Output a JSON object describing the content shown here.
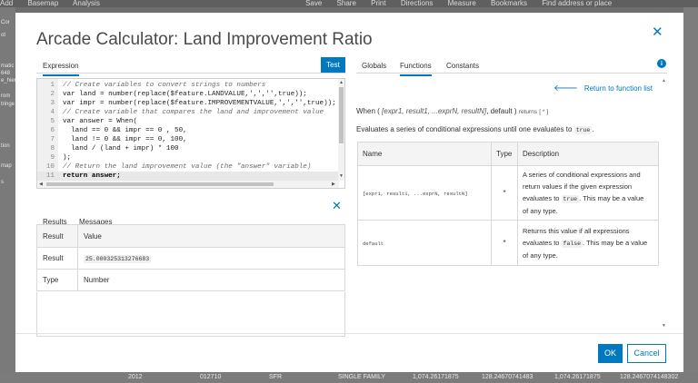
{
  "background_app": {
    "toolbar": [
      "Add",
      "Basemap",
      "Analysis",
      "Save",
      "Share",
      "Print",
      "Directions",
      "Measure",
      "Bookmarks",
      "Find address or place"
    ],
    "left_fragments": [
      "Cor",
      "ot",
      "matic",
      "648",
      "e_hier",
      "rom",
      "tringe",
      "tion",
      "map",
      "s"
    ],
    "bottom_row": [
      "2012",
      "012710",
      "SFR",
      "SINGLE FAMILY",
      "1,074.26171875",
      "128.24670741483",
      "1,074.26171875",
      "128.2467074148302"
    ]
  },
  "dialog": {
    "title": "Arcade Calculator: Land Improvement Ratio",
    "close_icon": "close-icon"
  },
  "left_panel": {
    "tab_expression": "Expression",
    "test_button": "Test",
    "code_lines": [
      {
        "n": "1",
        "text": "// Create variables to convert strings to numbers"
      },
      {
        "n": "2",
        "text": "var land = number(replace($feature.LANDVALUE,',','',true));"
      },
      {
        "n": "3",
        "text": "var impr = number(replace($feature.IMPROVEMENTVALUE,',','',true));"
      },
      {
        "n": "4",
        "text": "// Create variable that compares the land and improvement value"
      },
      {
        "n": "5",
        "text": "var answer = When("
      },
      {
        "n": "6",
        "text": "  land == 0 && impr == 0 , 50,"
      },
      {
        "n": "7",
        "text": "  land != 0 && impr == 0, 100,"
      },
      {
        "n": "8",
        "text": "  land / (land + impr) * 100"
      },
      {
        "n": "9",
        "text": ");"
      },
      {
        "n": "10",
        "text": "// Return the land improvement value (the \"answer\" variable)"
      },
      {
        "n": "11",
        "text": "return answer;"
      },
      {
        "n": "12",
        "text": ""
      }
    ],
    "results_tabs": {
      "results": "Results",
      "messages": "Messages"
    },
    "results_table": {
      "header": {
        "col1": "Result",
        "col2": "Value"
      },
      "rows": [
        {
          "label": "Result",
          "value": "25.000325313276683"
        },
        {
          "label": "Type",
          "value": "Number"
        }
      ]
    }
  },
  "right_panel": {
    "tabs": {
      "globals": "Globals",
      "functions": "Functions",
      "constants": "Constants"
    },
    "info_icon": "i",
    "return_link": "Return to function list",
    "signature": {
      "prefix": "When (",
      "params": "[expr1, result1, ...exprN, resultN]",
      "suffix": ", default )",
      "returns_label": "returns",
      "returns_type": "[ * ]"
    },
    "description": {
      "before": "Evaluates a series of conditional expressions until one evaluates to",
      "code": "true",
      "after": "."
    },
    "table": {
      "headers": {
        "name": "Name",
        "type": "Type",
        "description": "Description"
      },
      "rows": [
        {
          "name": "[expr1, result1, ...exprN, resultN]",
          "type": "*",
          "lines": [
            "A series of conditional expressions and",
            "return values if the given expression",
            "evaluates to",
            "true",
            ". This may be a value",
            "of any type."
          ]
        },
        {
          "name": "default",
          "type": "*",
          "lines": [
            "Returns this value if all expressions",
            "evaluates to",
            "false",
            ". This may be a value",
            "of any type."
          ]
        }
      ]
    }
  },
  "footer": {
    "ok": "OK",
    "cancel": "Cancel"
  },
  "colors": {
    "accent": "#0079c1",
    "overlay": "#6e6e6e"
  }
}
